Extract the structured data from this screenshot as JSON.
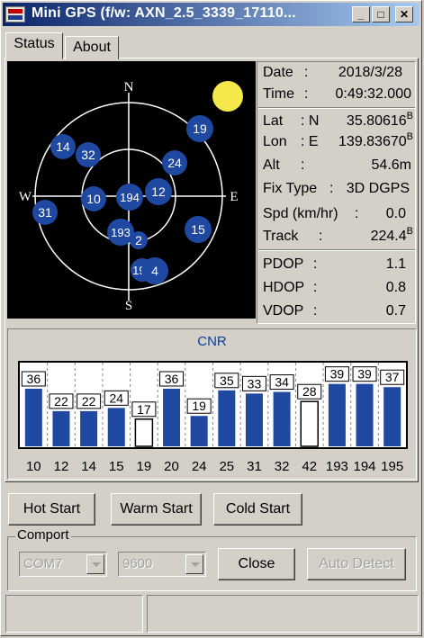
{
  "window": {
    "title": "Mini GPS (f/w: AXN_2.5_3339_17110...",
    "min_glyph": "_",
    "max_glyph": "□",
    "close_glyph": "✕",
    "accent": "#0a246a"
  },
  "tabs": [
    {
      "label": "Status",
      "active": true
    },
    {
      "label": "About",
      "active": false
    }
  ],
  "skyplot": {
    "compass": {
      "n": "N",
      "s": "S",
      "e": "E",
      "w": "W"
    },
    "sat_color": "#1f48a0",
    "sun_color": "#f4e84a",
    "satellites": [
      {
        "prn": "14"
      },
      {
        "prn": "32"
      },
      {
        "prn": "19"
      },
      {
        "prn": "24"
      },
      {
        "prn": "10"
      },
      {
        "prn": "194"
      },
      {
        "prn": "12"
      },
      {
        "prn": "31"
      },
      {
        "prn": "193"
      },
      {
        "prn": "2"
      },
      {
        "prn": "15"
      },
      {
        "prn": "195"
      },
      {
        "prn": "4"
      }
    ]
  },
  "info": {
    "date": {
      "label": "Date",
      "value": "2018/3/28"
    },
    "time": {
      "label": "Time",
      "value": "0:49:32.000"
    },
    "lat": {
      "label": "Lat",
      "dir": "N",
      "value": "35.80616",
      "flag": "B"
    },
    "lon": {
      "label": "Lon",
      "dir": "E",
      "value": "139.83670",
      "flag": "B"
    },
    "alt": {
      "label": "Alt",
      "value": "54.6m"
    },
    "fix": {
      "label": "Fix Type",
      "value": "3D DGPS"
    },
    "spd": {
      "label": "Spd (km/hr)",
      "value": "0.0"
    },
    "track": {
      "label": "Track",
      "value": "224.4",
      "flag": "B"
    },
    "pdop": {
      "label": "PDOP",
      "value": "1.1"
    },
    "hdop": {
      "label": "HDOP",
      "value": "0.8"
    },
    "vdop": {
      "label": "VDOP",
      "value": "0.7"
    }
  },
  "cnr": {
    "title": "CNR",
    "bar_color": "#1f48a0",
    "bars": [
      {
        "prn": "10",
        "value": 36,
        "used": true
      },
      {
        "prn": "12",
        "value": 22,
        "used": true
      },
      {
        "prn": "14",
        "value": 22,
        "used": true
      },
      {
        "prn": "15",
        "value": 24,
        "used": true
      },
      {
        "prn": "19",
        "value": 17,
        "used": false
      },
      {
        "prn": "20",
        "value": 36,
        "used": true
      },
      {
        "prn": "24",
        "value": 19,
        "used": true
      },
      {
        "prn": "25",
        "value": 35,
        "used": true
      },
      {
        "prn": "31",
        "value": 33,
        "used": true
      },
      {
        "prn": "32",
        "value": 34,
        "used": true
      },
      {
        "prn": "42",
        "value": 28,
        "used": false
      },
      {
        "prn": "193",
        "value": 39,
        "used": true
      },
      {
        "prn": "194",
        "value": 39,
        "used": true
      },
      {
        "prn": "195",
        "value": 37,
        "used": true
      }
    ]
  },
  "buttons": {
    "hot": "Hot Start",
    "warm": "Warm Start",
    "cold": "Cold Start",
    "close": "Close",
    "auto": "Auto Detect"
  },
  "comport": {
    "title": "Comport",
    "port": "COM7",
    "baud": "9600"
  }
}
